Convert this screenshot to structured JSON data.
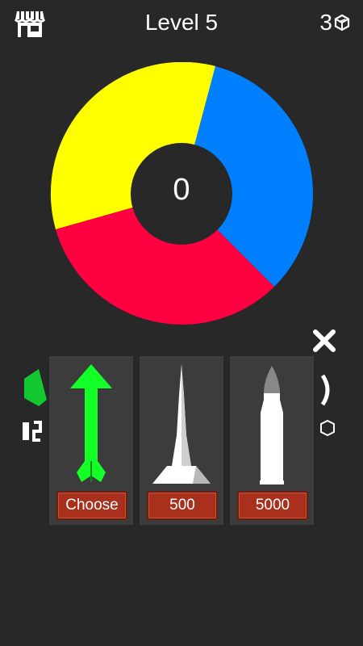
{
  "header": {
    "level_label": "Level 5",
    "coins": "3",
    "shop_icon": "shop-icon",
    "coin_icon": "cube-coin-icon"
  },
  "wheel": {
    "score": "0",
    "segments": [
      {
        "color": "#ffff00"
      },
      {
        "color": "#0080ff"
      },
      {
        "color": "#ff0040"
      }
    ]
  },
  "shop_panel": {
    "close_icon": "close-icon",
    "items": [
      {
        "weapon": "green-arrow",
        "button_label": "Choose"
      },
      {
        "weapon": "white-spike",
        "button_label": "500"
      },
      {
        "weapon": "bullet",
        "button_label": "5000"
      }
    ]
  },
  "colors": {
    "background": "#282828",
    "panel": "#3c3c3c",
    "button": "#a8301d",
    "arrow": "#14ff28"
  }
}
